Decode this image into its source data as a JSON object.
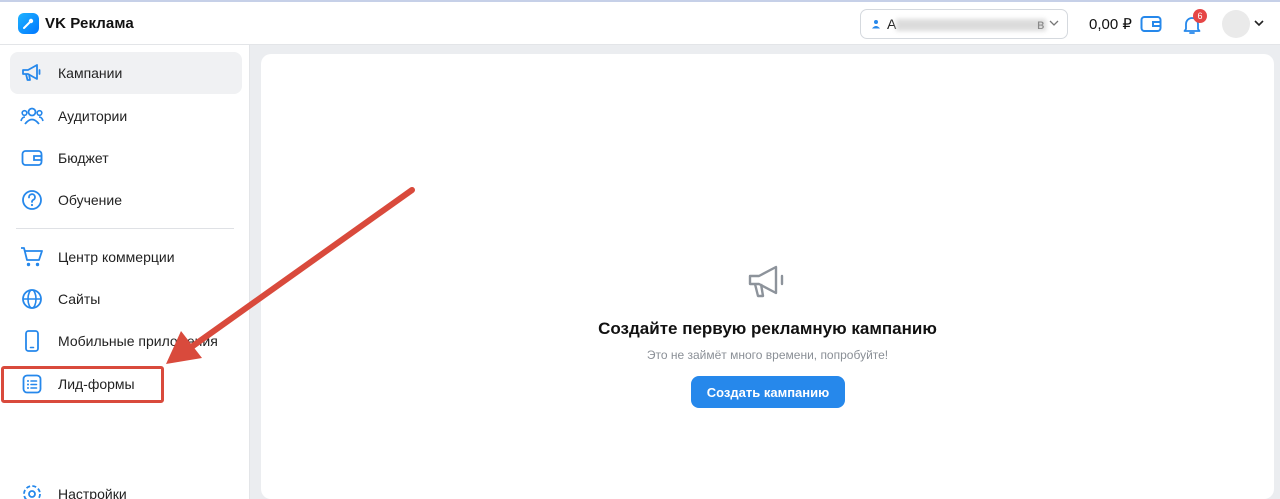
{
  "header": {
    "logo_text": "VK Реклама",
    "account_prefix": "А",
    "account_suffix": "в",
    "balance": "0,00 ₽",
    "notifications_count": "6"
  },
  "sidebar": {
    "items": [
      {
        "label": "Кампании",
        "icon": "megaphone-icon",
        "active": true
      },
      {
        "label": "Аудитории",
        "icon": "users-icon"
      },
      {
        "label": "Бюджет",
        "icon": "wallet-icon"
      },
      {
        "label": "Обучение",
        "icon": "question-icon"
      },
      {
        "label": "Центр коммерции",
        "icon": "cart-icon"
      },
      {
        "label": "Сайты",
        "icon": "globe-icon"
      },
      {
        "label": "Мобильные приложения",
        "icon": "phone-icon"
      },
      {
        "label": "Лид-формы",
        "icon": "list-form-icon"
      },
      {
        "label": "Настройки",
        "icon": "gear-icon"
      }
    ]
  },
  "main": {
    "empty_title": "Создайте первую рекламную кампанию",
    "empty_subtitle": "Это не займёт много времени, попробуйте!",
    "create_button": "Создать кампанию"
  },
  "colors": {
    "accent": "#2688eb",
    "annotation": "#d94a3c",
    "badge": "#e64646"
  }
}
